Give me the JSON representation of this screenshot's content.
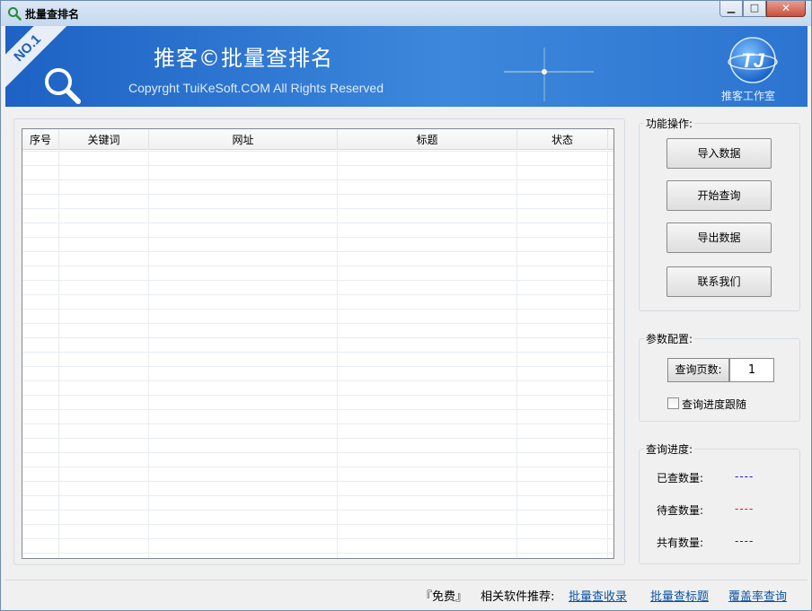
{
  "window": {
    "title": "批量查排名"
  },
  "banner": {
    "badge": "NO.1",
    "title": "推客©批量查排名",
    "copyright": "Copyrght TuiKeSoft.COM All Rights Reserved",
    "studio": "推客工作室",
    "logo_text": "TJ"
  },
  "grid": {
    "columns": [
      "序号",
      "关键词",
      "网址",
      "标题",
      "状态"
    ]
  },
  "functions": {
    "label": "功能操作:",
    "buttons": [
      "导入数据",
      "开始查询",
      "导出数据",
      "联系我们"
    ]
  },
  "params": {
    "label": "参数配置:",
    "pages_label": "查询页数:",
    "pages_value": "1",
    "follow_label": "查询进度跟随",
    "follow_checked": false
  },
  "progress": {
    "label": "查询进度:",
    "items": [
      {
        "label": "已查数量:",
        "value": "----",
        "color": "#1a1ad8"
      },
      {
        "label": "待查数量:",
        "value": "----",
        "color": "#e01818"
      },
      {
        "label": "共有数量:",
        "value": "----",
        "color": "#1a1ad8"
      }
    ]
  },
  "status": {
    "free": "『免费』",
    "recommend": "相关软件推荐:",
    "links": [
      "批量查收录",
      "批量查标题",
      "覆盖率查询"
    ]
  }
}
